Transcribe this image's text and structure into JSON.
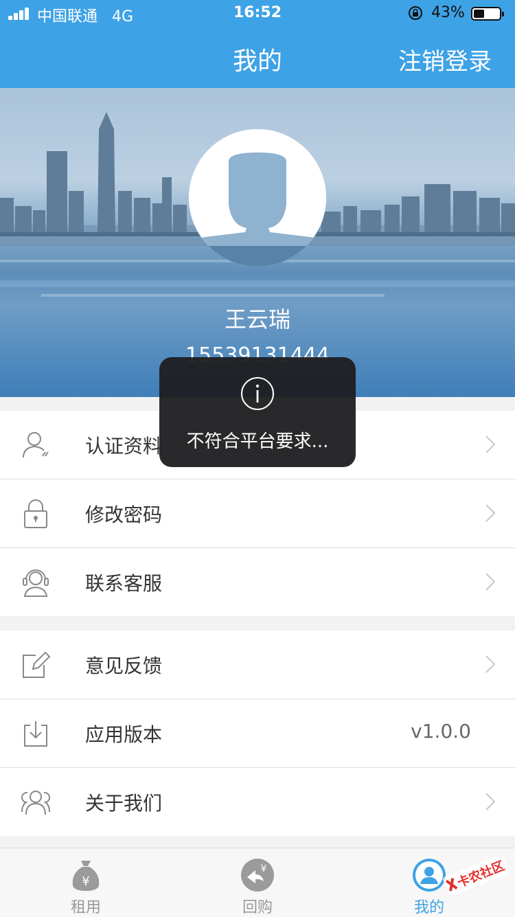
{
  "status_bar": {
    "carrier": "中国联通",
    "network": "4G",
    "time": "16:52",
    "battery": "43%",
    "battery_level": 0.43
  },
  "nav": {
    "title": "我的",
    "logout": "注销登录"
  },
  "profile": {
    "name": "王云瑞",
    "phone": "15539131444"
  },
  "toast": {
    "message": "不符合平台要求..."
  },
  "menu_group_1": [
    {
      "label": "认证资料",
      "icon": "user-verify-icon"
    },
    {
      "label": "修改密码",
      "icon": "lock-icon"
    },
    {
      "label": "联系客服",
      "icon": "headset-icon"
    }
  ],
  "menu_group_2": [
    {
      "label": "意见反馈",
      "icon": "edit-icon"
    },
    {
      "label": "应用版本",
      "icon": "download-icon",
      "value": "v1.0.0"
    },
    {
      "label": "关于我们",
      "icon": "users-icon"
    }
  ],
  "tabs": [
    {
      "label": "租用",
      "icon": "money-bag-icon"
    },
    {
      "label": "回购",
      "icon": "buyback-icon"
    },
    {
      "label": "我的",
      "icon": "profile-icon",
      "active": true
    }
  ],
  "watermark": "卡农社区",
  "colors": {
    "primary": "#3ea2e6",
    "text": "#333333",
    "muted": "#999999"
  }
}
